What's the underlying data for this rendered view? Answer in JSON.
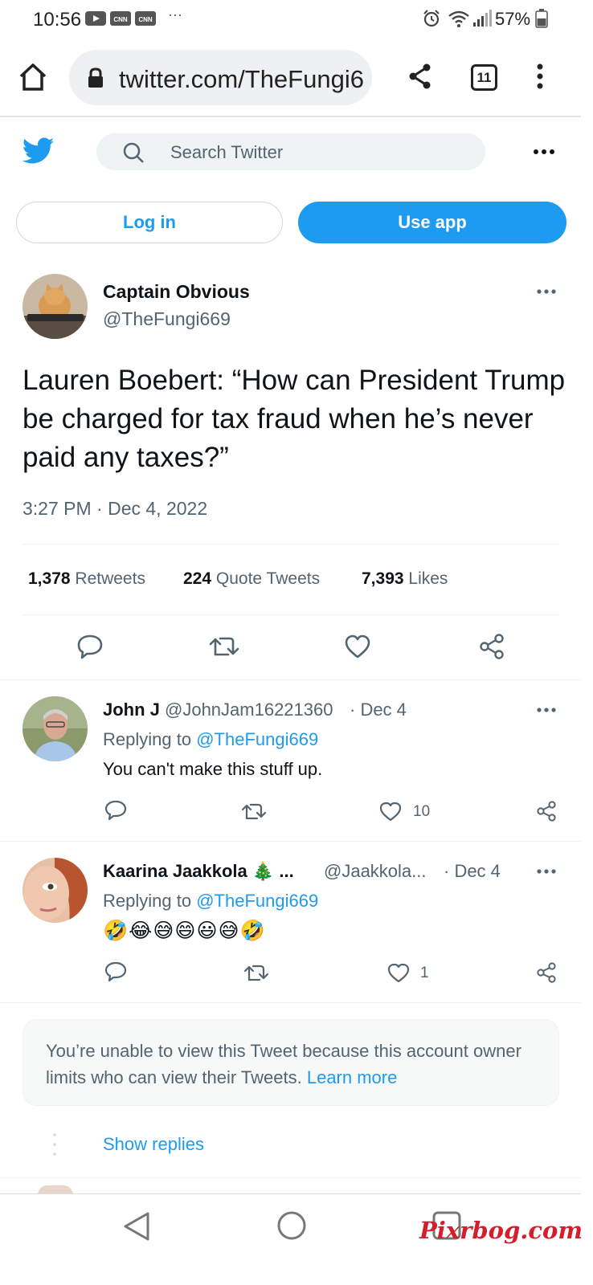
{
  "status_bar": {
    "time": "10:56",
    "battery": "57%",
    "notification_icons": [
      "youtube-icon",
      "cnn-icon",
      "cnn-icon"
    ],
    "overflow": "···"
  },
  "browser": {
    "url": "twitter.com/TheFungi669",
    "tab_count": "11"
  },
  "twitter_header": {
    "search_placeholder": "Search Twitter",
    "login_label": "Log in",
    "use_app_label": "Use app"
  },
  "tweet": {
    "author_name": "Captain Obvious",
    "author_handle": "@TheFungi669",
    "text": "Lauren Boebert: “How can President Trump be charged for tax fraud when he’s never paid any taxes?”",
    "timestamp": "3:27 PM · Dec 4, 2022",
    "retweets": "1,378",
    "retweets_label": "Retweets",
    "quotes": "224",
    "quotes_label": "Quote Tweets",
    "likes": "7,393",
    "likes_label": "Likes"
  },
  "replies": [
    {
      "name": "John J",
      "handle": "@JohnJam16221360",
      "date": "· Dec 4",
      "replying_prefix": "Replying to",
      "replying_to": "@TheFungi669",
      "text": "You can't make this stuff up.",
      "likes": "10"
    },
    {
      "name": "Kaarina Jaakkola 🎄 ...",
      "handle": "@Jaakkola...",
      "date": "· Dec 4",
      "replying_prefix": "Replying to",
      "replying_to": "@TheFungi669",
      "text": "🤣😂😅😄😃😅🤣",
      "likes": "1"
    }
  ],
  "protected_notice": {
    "text": "You’re unable to view this Tweet because this account owner limits who can view their Tweets.",
    "link": "Learn more"
  },
  "show_replies_label": "Show replies",
  "watermark": "Pixrbog.com",
  "colors": {
    "twitter_blue": "#1d9bf0",
    "text_primary": "#0f1419",
    "text_secondary": "#536471",
    "watermark_red": "#d21f2b"
  }
}
